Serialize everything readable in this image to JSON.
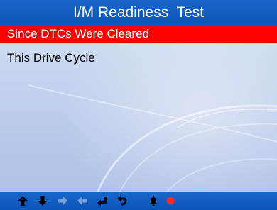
{
  "title": "I/M Readiness  Test",
  "menu": {
    "items": [
      {
        "label": "Since DTCs Were Cleared",
        "selected": true
      },
      {
        "label": "This Drive Cycle",
        "selected": false
      }
    ]
  },
  "colors": {
    "header_bar": "#0d55b8",
    "selected_row": "#ff0000",
    "background": "#c7d7ef",
    "record_indicator": "#ff2a2a"
  },
  "bottom_bar": {
    "icons": [
      {
        "name": "arrow-up-icon",
        "enabled": true
      },
      {
        "name": "arrow-down-icon",
        "enabled": true
      },
      {
        "name": "arrow-right-icon",
        "enabled": false
      },
      {
        "name": "arrow-left-icon",
        "enabled": false
      },
      {
        "name": "enter-icon",
        "enabled": true
      },
      {
        "name": "back-icon",
        "enabled": true
      },
      {
        "name": "bell-icon",
        "enabled": true
      },
      {
        "name": "record-indicator-icon",
        "enabled": true
      }
    ]
  }
}
